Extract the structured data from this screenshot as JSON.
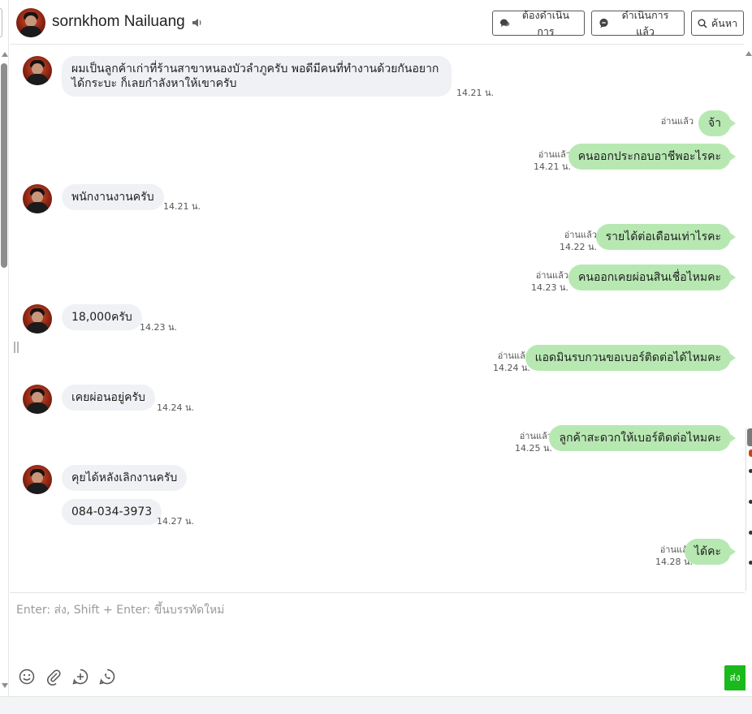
{
  "header": {
    "contact_name": "sornkhom Nailuang",
    "btn_todo": "ต้องดำเนินการ",
    "btn_done": "ดำเนินการแล้ว",
    "btn_search": "ค้นหา"
  },
  "messages": [
    {
      "dir": "in",
      "avatar": true,
      "text": "ผมเป็นลูกค้าเก่าที่ร้านสาขาหนองบัวลำภูครับ พอดีมีคนที่ทำงานด้วยกันอยากได้กระบะ ก็เลยกำลังหาให้เขาครับ",
      "time": "14.21 น."
    },
    {
      "dir": "out",
      "read": "อ่านแล้ว",
      "text": "จ้า",
      "time": ""
    },
    {
      "dir": "out",
      "read": "อ่านแล้ว",
      "text": "คนออกประกอบอาชีพอะไรคะ",
      "time": "14.21 น."
    },
    {
      "dir": "in",
      "avatar": true,
      "text": "พนักงานงานครับ",
      "time": "14.21 น."
    },
    {
      "dir": "out",
      "read": "อ่านแล้ว",
      "text": "รายได้ต่อเดือนเท่าไรคะ",
      "time": "14.22 น."
    },
    {
      "dir": "out",
      "read": "อ่านแล้ว",
      "text": "คนออกเคยผ่อนสินเชื่อไหมคะ",
      "time": "14.23 น."
    },
    {
      "dir": "in",
      "avatar": true,
      "text": "18,000ครับ",
      "time": "14.23 น."
    },
    {
      "dir": "out",
      "read": "อ่านแล้ว",
      "text": "แอดมินรบกวนขอเบอร์ติดต่อได้ไหมคะ",
      "time": "14.24 น."
    },
    {
      "dir": "in",
      "avatar": true,
      "text": "เคยผ่อนอยู่ครับ",
      "time": "14.24 น."
    },
    {
      "dir": "out",
      "read": "อ่านแล้ว",
      "text": "ลูกค้าสะดวกให้เบอร์ติดต่อไหมคะ",
      "time": "14.25 น."
    },
    {
      "dir": "in",
      "avatar": true,
      "text": "คุยได้หลังเลิกงานครับ",
      "time": ""
    },
    {
      "dir": "in",
      "avatar": false,
      "text": "084-034-3973",
      "time": "14.27 น."
    },
    {
      "dir": "out",
      "read": "อ่านแล้ว",
      "text": "ได้คะ",
      "time": "14.28 น."
    }
  ],
  "composer": {
    "placeholder": "Enter: ส่ง, Shift + Enter: ขึ้นบรรทัดใหม่",
    "send_label": "ส่ง"
  },
  "icons": {
    "speaker": "speaker-icon",
    "todo": "speech-bubble-icon",
    "done": "chat-bubble-icon",
    "search": "search-icon",
    "emoji": "emoji-icon",
    "attach": "paperclip-icon",
    "add": "add-circle-icon",
    "call": "phone-bubble-icon"
  },
  "colors": {
    "outgoing_bubble": "#b7e8b2",
    "incoming_bubble": "#f0f1f4",
    "send_button": "#1ab91c"
  }
}
